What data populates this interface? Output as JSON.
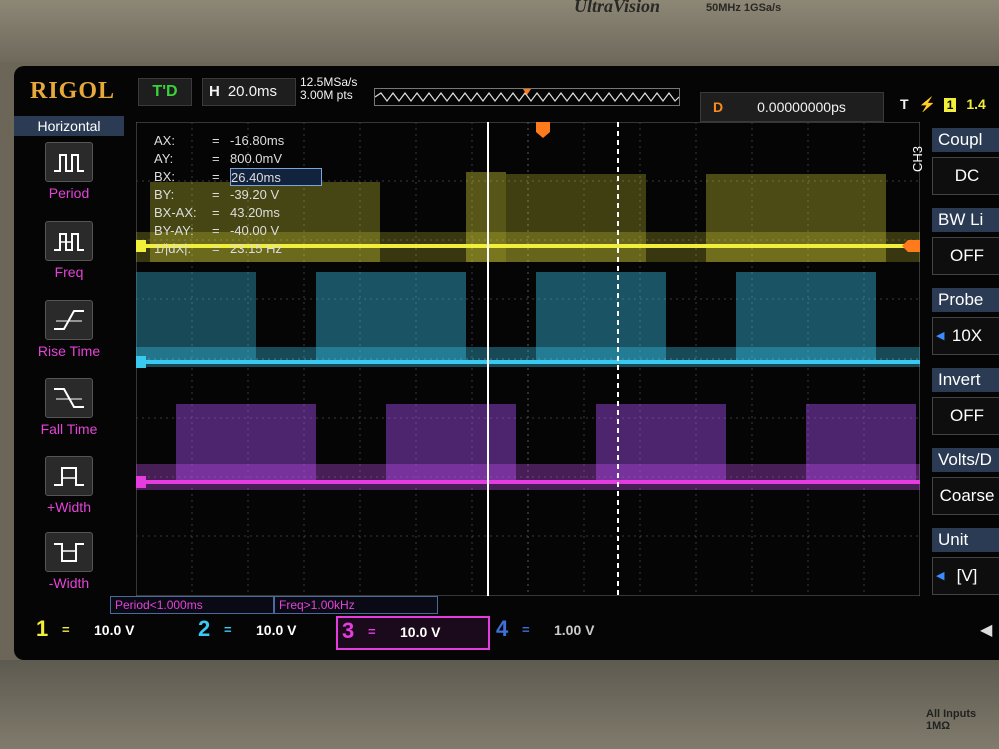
{
  "device": {
    "model_text": "UltraVision",
    "spec_text": "50MHz  1GSa/s",
    "bottom_label": "All Inputs 1MΩ"
  },
  "status_bar": {
    "logo": "RIGOL",
    "trigger_status": "T'D",
    "horizontal_label": "H",
    "timebase": "20.0ms",
    "sample_rate": "12.5MSa/s",
    "memory_depth": "3.00M pts",
    "delay_label": "D",
    "delay_value": "0.00000000ps",
    "trigger_type_label": "T",
    "trigger_source": "1",
    "trigger_level_partial": "1.4"
  },
  "left_menu": {
    "title": "Horizontal",
    "items": [
      {
        "label": "Period",
        "icon": "period-icon"
      },
      {
        "label": "Freq",
        "icon": "frequency-icon"
      },
      {
        "label": "Rise Time",
        "icon": "rise-time-icon"
      },
      {
        "label": "Fall Time",
        "icon": "fall-time-icon"
      },
      {
        "label": "+Width",
        "icon": "positive-width-icon"
      },
      {
        "label": "-Width",
        "icon": "negative-width-icon"
      }
    ]
  },
  "cursor_readout": [
    {
      "key": "AX:",
      "value": "-16.80ms"
    },
    {
      "key": "AY:",
      "value": "800.0mV"
    },
    {
      "key": "BX:",
      "value": "26.40ms"
    },
    {
      "key": "BY:",
      "value": "-39.20 V"
    },
    {
      "key": "BX-AX:",
      "value": "43.20ms"
    },
    {
      "key": "BY-AY:",
      "value": "-40.00 V"
    },
    {
      "key": "1/|dX|:",
      "value": "23.15 Hz"
    }
  ],
  "bottom_status": {
    "period": "Period<1.000ms",
    "freq": "Freq>1.00kHz"
  },
  "channels": [
    {
      "num": "1",
      "coupling": "=",
      "scale": "10.0 V",
      "color": "#f2ef3c"
    },
    {
      "num": "2",
      "coupling": "=",
      "scale": "10.0 V",
      "color": "#3ac9f0"
    },
    {
      "num": "3",
      "coupling": "=",
      "scale": "10.0 V",
      "color": "#e53ce0"
    },
    {
      "num": "4",
      "coupling": "=",
      "scale": "1.00 V",
      "color": "#3f6fd8"
    }
  ],
  "right_menu": {
    "channel_tag": "CH3",
    "items": [
      {
        "header": "Coupl",
        "value": "DC"
      },
      {
        "header": "BW Li",
        "value": "OFF"
      },
      {
        "header": "Probe",
        "value": "10X"
      },
      {
        "header": "Invert",
        "value": "OFF"
      },
      {
        "header": "Volts/D",
        "value": "Coarse"
      },
      {
        "header": "Unit",
        "value": "[V]"
      }
    ]
  },
  "colors": {
    "ch1": "#f2ef3c",
    "ch2": "#3ac9f0",
    "ch3": "#e53ce0",
    "ch4": "#3f6fd8",
    "logo": "#e8a93a",
    "trigger_marker": "#ff7a1a"
  }
}
